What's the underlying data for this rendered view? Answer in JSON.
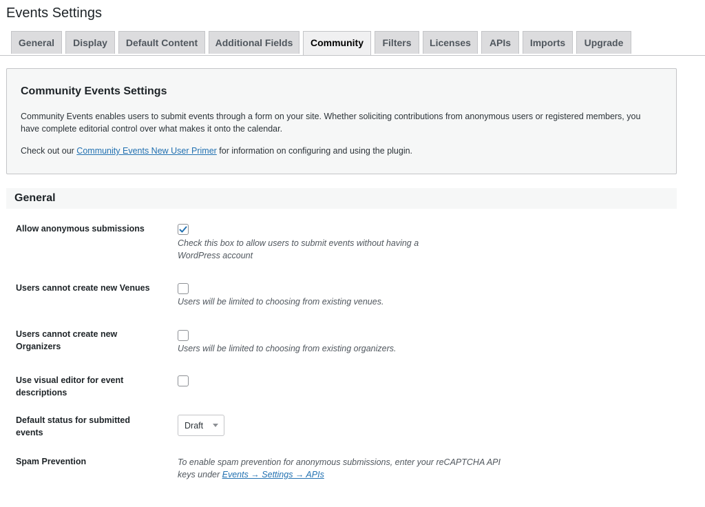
{
  "page": {
    "title": "Events Settings"
  },
  "tabs": [
    {
      "label": "General"
    },
    {
      "label": "Display"
    },
    {
      "label": "Default Content"
    },
    {
      "label": "Additional Fields"
    },
    {
      "label": "Community",
      "active": true
    },
    {
      "label": "Filters"
    },
    {
      "label": "Licenses"
    },
    {
      "label": "APIs"
    },
    {
      "label": "Imports"
    },
    {
      "label": "Upgrade"
    }
  ],
  "intro": {
    "title": "Community Events Settings",
    "text": "Community Events enables users to submit events through a form on your site. Whether soliciting contributions from anonymous users or registered members, you have complete editorial control over what makes it onto the calendar.",
    "primer_prefix": "Check out our ",
    "primer_link": "Community Events New User Primer",
    "primer_suffix": " for information on configuring and using the plugin."
  },
  "section": {
    "title": "General"
  },
  "settings": {
    "anonymous": {
      "label": "Allow anonymous submissions",
      "checked": true,
      "description": "Check this box to allow users to submit events without having a WordPress account"
    },
    "venues": {
      "label": "Users cannot create new Venues",
      "checked": false,
      "description": "Users will be limited to choosing from existing venues."
    },
    "organizers": {
      "label": "Users cannot create new Organizers",
      "checked": false,
      "description": "Users will be limited to choosing from existing organizers."
    },
    "visual_editor": {
      "label": "Use visual editor for event descriptions",
      "checked": false
    },
    "default_status": {
      "label": "Default status for submitted events",
      "value": "Draft"
    },
    "spam": {
      "label": "Spam Prevention",
      "text": "To enable spam prevention for anonymous submissions, enter your reCAPTCHA API keys under ",
      "link": "Events → Settings → APIs"
    }
  },
  "colors": {
    "accent": "#2271b1",
    "check": "#2271b1"
  }
}
